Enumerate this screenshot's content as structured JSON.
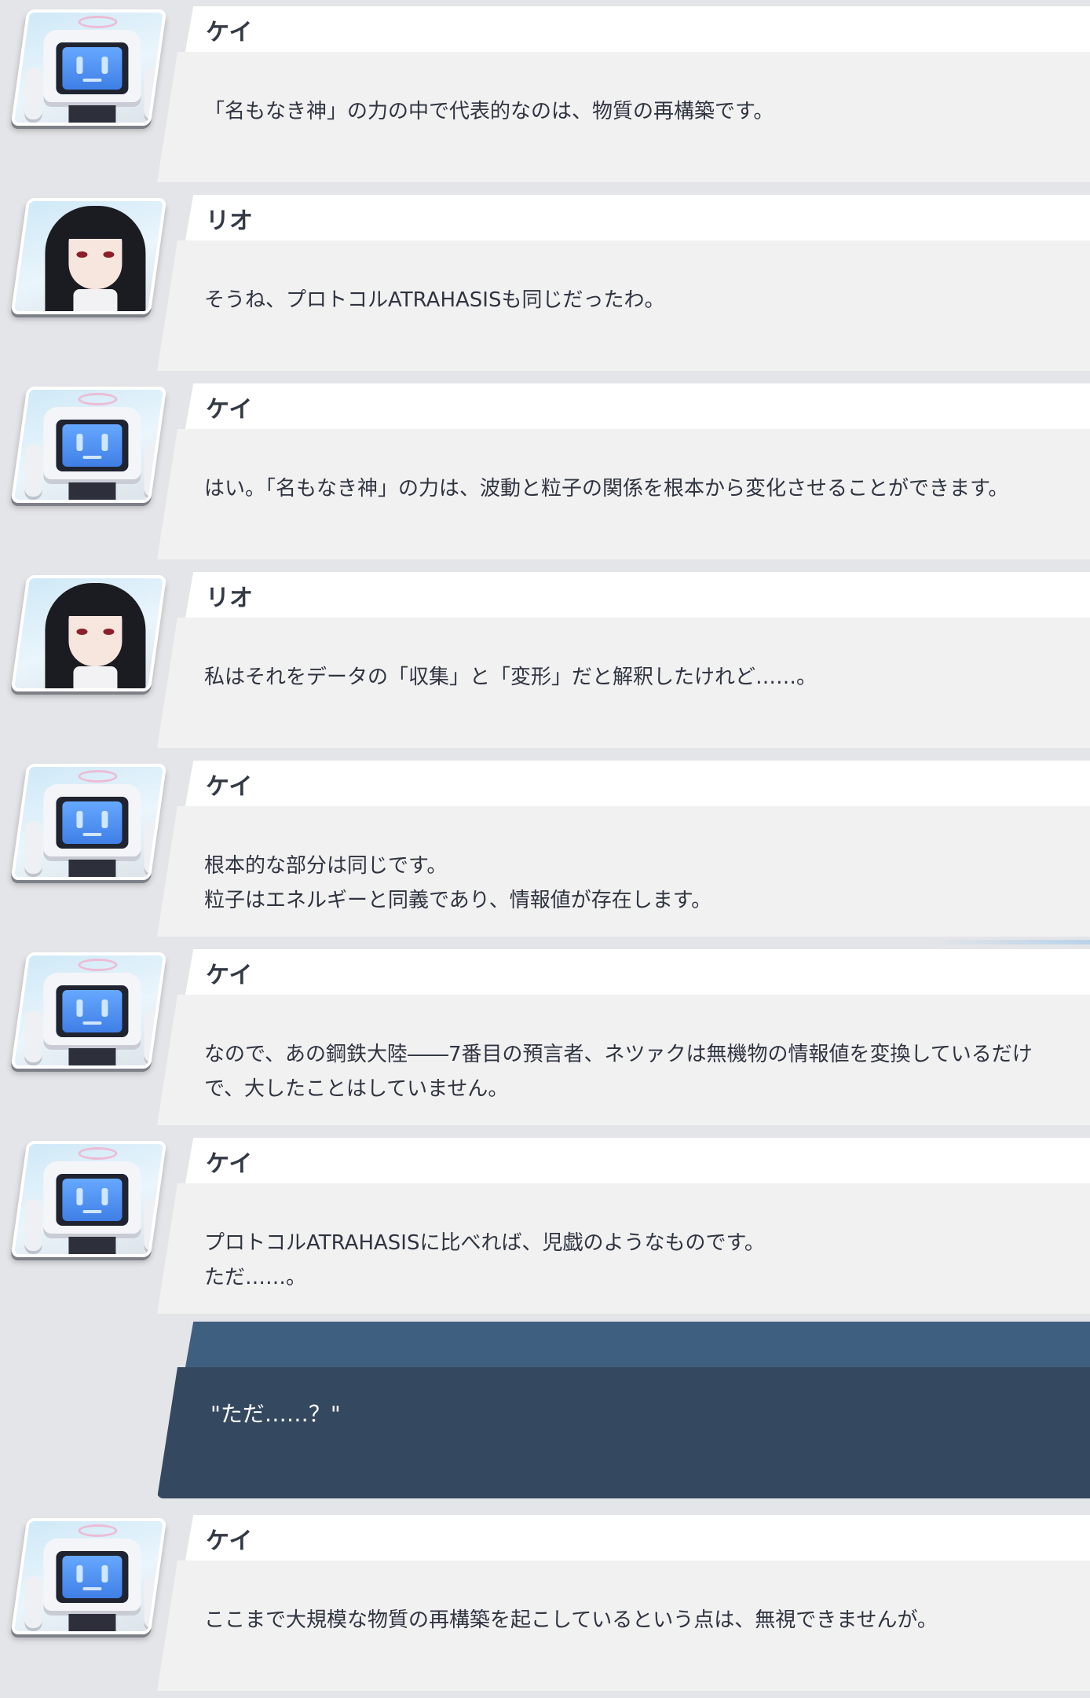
{
  "log": [
    {
      "type": "message",
      "speaker": "ケイ",
      "avatar": "robot",
      "lines": [
        "「名もなき神」の力の中で代表的なのは、物質の再構築です。"
      ]
    },
    {
      "type": "message",
      "speaker": "リオ",
      "avatar": "girl",
      "lines": [
        "そうね、プロトコルATRAHASISも同じだったわ。"
      ]
    },
    {
      "type": "message",
      "speaker": "ケイ",
      "avatar": "robot",
      "lines": [
        "はい。「名もなき神」の力は、波動と粒子の関係を根本から変化させることができます。"
      ]
    },
    {
      "type": "message",
      "speaker": "リオ",
      "avatar": "girl",
      "lines": [
        "私はそれをデータの「収集」と「変形」だと解釈したけれど……。"
      ]
    },
    {
      "type": "message",
      "speaker": "ケイ",
      "avatar": "robot",
      "lines": [
        "根本的な部分は同じです。",
        "粒子はエネルギーと同義であり、情報値が存在します。"
      ]
    },
    {
      "type": "message",
      "speaker": "ケイ",
      "avatar": "robot",
      "lines": [
        "なので、あの鋼鉄大陸――7番目の預言者、ネツァクは無機物の情報値を変換しているだけ",
        "で、大したことはしていません。"
      ]
    },
    {
      "type": "message",
      "speaker": "ケイ",
      "avatar": "robot",
      "lines": [
        "プロトコルATRAHASISに比べれば、児戯のようなものです。",
        "ただ……。"
      ]
    },
    {
      "type": "choice",
      "text": "\"ただ……？\""
    },
    {
      "type": "message",
      "speaker": "ケイ",
      "avatar": "robot",
      "lines": [
        "ここまで大規模な物質の再構築を起こしているという点は、無視できませんが。"
      ]
    }
  ],
  "colors": {
    "background": "#e4e5e8",
    "name_strip": "#ffffff",
    "message_body": "#f1f1f2",
    "choice_top": "#3f5f80",
    "choice_body": "#34495f",
    "text": "#2f3440"
  }
}
